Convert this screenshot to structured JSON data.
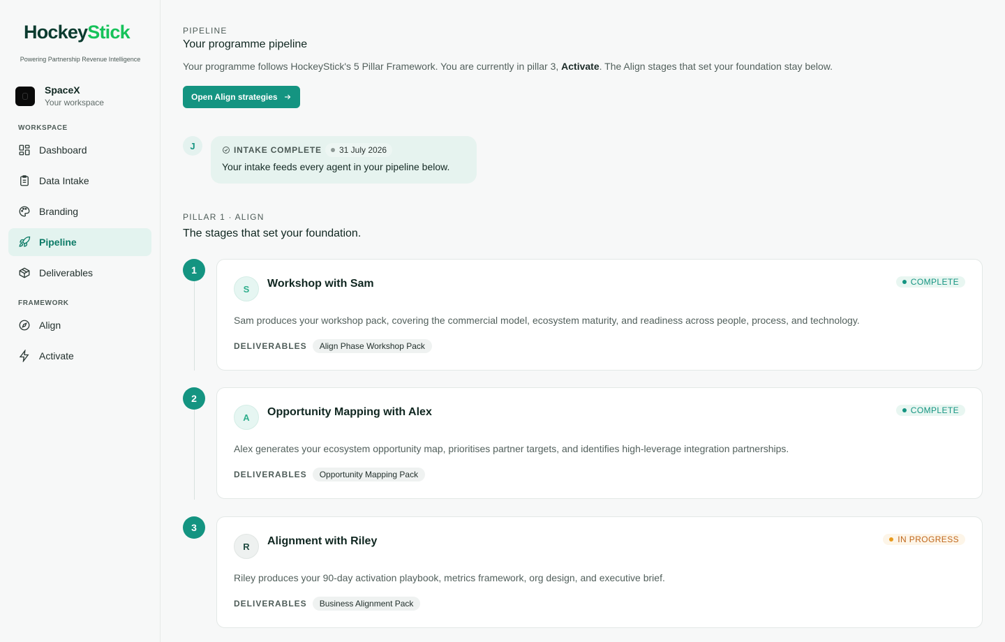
{
  "brand": {
    "logo_part1": "Hockey",
    "logo_part2": "Stick",
    "tagline": "Powering Partnership Revenue Intelligence"
  },
  "workspace": {
    "name": "SpaceX",
    "subtitle": "Your workspace"
  },
  "sidebar": {
    "section1": "WORKSPACE",
    "section2": "FRAMEWORK",
    "items": [
      {
        "label": "Dashboard",
        "icon": "dashboard-icon"
      },
      {
        "label": "Data Intake",
        "icon": "clipboard-icon"
      },
      {
        "label": "Branding",
        "icon": "palette-icon"
      },
      {
        "label": "Pipeline",
        "icon": "rocket-icon",
        "active": true
      },
      {
        "label": "Deliverables",
        "icon": "package-icon"
      },
      {
        "label": "Align",
        "icon": "compass-icon"
      },
      {
        "label": "Activate",
        "icon": "bolt-icon"
      }
    ]
  },
  "header": {
    "eyebrow": "PIPELINE",
    "title": "Your programme pipeline",
    "lead_pre": "Your programme follows HockeyStick's 5 Pillar Framework. You are currently in pillar 3, ",
    "lead_bold": "Activate",
    "lead_post": ". The Align stages that set your foundation stay below.",
    "button": "Open Align strategies"
  },
  "intake": {
    "avatar": "J",
    "tag": "INTAKE COMPLETE",
    "date": "31 July 2026",
    "text": "Your intake feeds every agent in your pipeline below."
  },
  "pillar": {
    "eyebrow": "PILLAR 1 · ALIGN",
    "title": "The stages that set your foundation."
  },
  "stages": [
    {
      "num": "1",
      "avatar": "S",
      "title": "Workshop with Sam",
      "status": "COMPLETE",
      "desc": "Sam produces your workshop pack, covering the commercial model, ecosystem maturity, and readiness across people, process, and technology.",
      "deliverables_label": "DELIVERABLES",
      "deliverable": "Align Phase Workshop Pack"
    },
    {
      "num": "2",
      "avatar": "A",
      "title": "Opportunity Mapping with Alex",
      "status": "COMPLETE",
      "desc": "Alex generates your ecosystem opportunity map, prioritises partner targets, and identifies high-leverage integration partnerships.",
      "deliverables_label": "DELIVERABLES",
      "deliverable": "Opportunity Mapping Pack"
    },
    {
      "num": "3",
      "avatar": "R",
      "title": "Alignment with Riley",
      "status": "IN PROGRESS",
      "desc": "Riley produces your 90-day activation playbook, metrics framework, org design, and executive brief.",
      "deliverables_label": "DELIVERABLES",
      "deliverable": "Business Alignment Pack"
    }
  ],
  "colors": {
    "accent": "#149481",
    "brand_green": "#16c25a",
    "progress": "#e89a1c"
  }
}
